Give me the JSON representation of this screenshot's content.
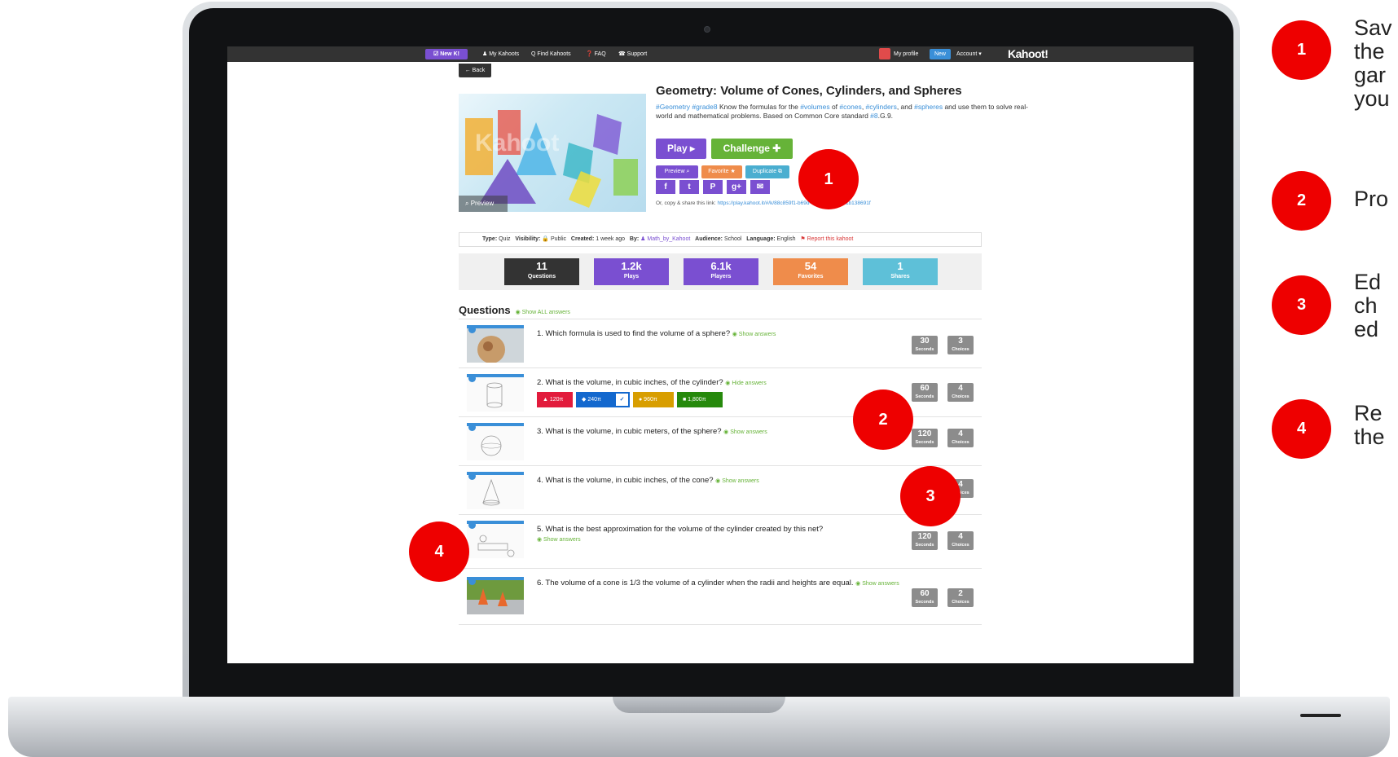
{
  "topbar": {
    "new_label": "☑ New K!",
    "my_kahoots": "♟ My Kahoots",
    "find_kahoots": "Q Find Kahoots",
    "faq": "❓ FAQ",
    "support": "☎ Support",
    "my_profile": "My profile",
    "new_badge": "New",
    "account": "Account ▾",
    "logo": "Kahoot!"
  },
  "back_label": "← Back",
  "game": {
    "title": "Geometry: Volume of Cones, Cylinders, and Spheres",
    "desc_tags_1": "#Geometry #grade8",
    "desc_1": " Know the formulas for the ",
    "desc_tag_volumes": "#volumes",
    "desc_2": " of ",
    "desc_tag_cones": "#cones",
    "desc_3": ", ",
    "desc_tag_cylinders": "#cylinders",
    "desc_4": ", and ",
    "desc_tag_spheres": "#spheres",
    "desc_5": " and use them to solve real-world and mathematical problems. Based on Common Core standard ",
    "desc_tag_std": "#8",
    "desc_6": ".G.9.",
    "cover_word": "Kahoot",
    "cover_preview": "⌕ Preview",
    "play_label": "Play ▸",
    "challenge_label": "Challenge ✚",
    "preview_label": "Preview ⌕",
    "favorite_label": "Favorite ★",
    "duplicate_label": "Duplicate ⧉",
    "social": [
      "f",
      "t",
      "P",
      "g+",
      "✉"
    ],
    "share_prefix": "Or, copy & share this link: ",
    "share_link": "https://play.kahoot.it/#/k/88c859f1-b69d-4a84-8e6e-6f61b138691f"
  },
  "meta": {
    "type_label": "Type:",
    "type_value": "Quiz",
    "visibility_label": "Visibility:",
    "visibility_value": "🔒 Public",
    "created_label": "Created:",
    "created_value": "1 week ago",
    "by_label": "By:",
    "by_value": "♟ Math_by_Kahoot",
    "audience_label": "Audience:",
    "audience_value": "School",
    "language_label": "Language:",
    "language_value": "English",
    "report": "⚑ Report this kahoot"
  },
  "stats": [
    {
      "value": "11",
      "label": "Questions",
      "color": "#333333"
    },
    {
      "value": "1.2k",
      "label": "Plays",
      "color": "#7a4fd1"
    },
    {
      "value": "6.1k",
      "label": "Players",
      "color": "#7a4fd1"
    },
    {
      "value": "54",
      "label": "Favorites",
      "color": "#ef8c4b"
    },
    {
      "value": "1",
      "label": "Shares",
      "color": "#5ec0d8"
    }
  ],
  "questions_heading": "Questions",
  "show_all_answers": "◉ Show ALL answers",
  "questions": [
    {
      "text": "1. Which formula is used to find the volume of a sphere?",
      "link": "◉ Show answers",
      "seconds": "30",
      "choices": "3"
    },
    {
      "text": "2. What is the volume, in cubic inches, of the cylinder?",
      "link": "◉ Hide answers",
      "seconds": "60",
      "choices": "4"
    },
    {
      "text": "3. What is the volume, in cubic meters, of the sphere?",
      "link": "◉ Show answers",
      "seconds": "120",
      "choices": "4"
    },
    {
      "text": "4. What is the volume, in cubic inches, of the cone?",
      "link": "◉ Show answers",
      "seconds": "90",
      "choices": "4"
    },
    {
      "text": "5. What is the best approximation for the volume of the cylinder created by this net?",
      "link": "◉ Show answers",
      "seconds": "120",
      "choices": "4"
    },
    {
      "text": "6. The volume of a cone is 1/3 the volume of a cylinder when the radii and heights are equal.",
      "link": "◉ Show answers",
      "seconds": "60",
      "choices": "2"
    }
  ],
  "seconds_label": "Seconds",
  "choices_label": "Choices",
  "answers_q2": [
    {
      "label": "▲ 120π",
      "color": "#e21b3c"
    },
    {
      "label": "◆ 240π",
      "color": "#1368ce"
    },
    {
      "label": "● 960π",
      "color": "#d89e00"
    },
    {
      "label": "■ 1,800π",
      "color": "#26890c"
    }
  ],
  "markers": [
    "1",
    "2",
    "3",
    "4"
  ],
  "legend": [
    {
      "num": "1",
      "text": "Sav\nthe\ngar\nyou"
    },
    {
      "num": "2",
      "text": "Pro"
    },
    {
      "num": "3",
      "text": "Ed\nch\ned"
    },
    {
      "num": "4",
      "text": "Re\nthe"
    }
  ]
}
